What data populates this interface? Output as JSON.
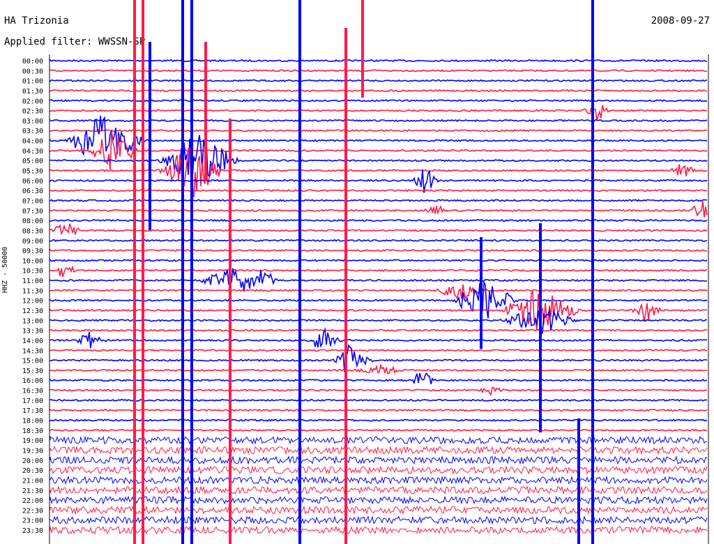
{
  "header": {
    "station": "HA Trizonia",
    "filter": "Applied filter: WWSSN-SP",
    "date": "2008-09-27"
  },
  "chart_data": {
    "type": "line",
    "title": "HA Trizonia",
    "subtitle": "Applied filter: WWSSN-SP",
    "date": "2008-09-27",
    "ylabel": "HHZ - 50000",
    "row_labels": [
      "00:00",
      "00:30",
      "01:00",
      "01:30",
      "02:00",
      "02:30",
      "03:00",
      "03:30",
      "04:00",
      "04:30",
      "05:00",
      "05:30",
      "06:00",
      "06:30",
      "07:00",
      "07:30",
      "08:00",
      "08:30",
      "09:00",
      "09:30",
      "10:00",
      "10:30",
      "11:00",
      "11:30",
      "12:00",
      "12:30",
      "13:00",
      "13:30",
      "14:00",
      "14:30",
      "15:00",
      "15:30",
      "16:00",
      "16:30",
      "17:00",
      "17:30",
      "18:00",
      "18:30",
      "19:00",
      "19:30",
      "20:00",
      "20:30",
      "21:00",
      "21:30",
      "22:00",
      "22:30",
      "23:00",
      "23:30"
    ],
    "colors": [
      "#0000ff",
      "#ff1a4a"
    ],
    "rows_per_hour": 2,
    "legend": "none",
    "grid": false
  }
}
